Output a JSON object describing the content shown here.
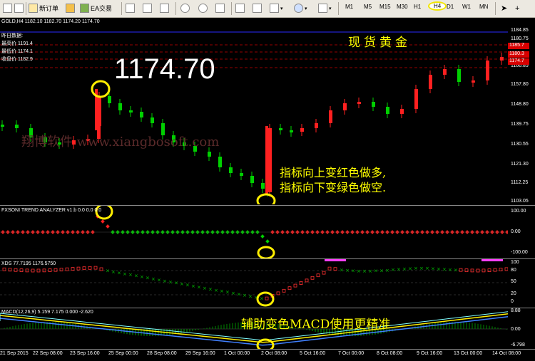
{
  "toolbar": {
    "new_order": "新订单",
    "ea": "EA交易",
    "timeframes": [
      "M1",
      "M5",
      "M15",
      "M30",
      "H1",
      "H4",
      "D1",
      "W1",
      "MN"
    ],
    "active_timeframe": "H4"
  },
  "main": {
    "header": "GOLD,H4  1182.10 1182.70 1174.20 1174.70",
    "info_title": "昨日数据:",
    "info_high": "最高价 1191.4",
    "info_low": "最低价 1174.1",
    "info_close": "收盘价 1182.9",
    "big_price": "1174.70",
    "watermark": "翔博软件 www.xiangbosoft.com",
    "title_cn": "现货黄金",
    "note_line1": "指标向上变红色做多,",
    "note_line2": "指标向下变绿色做空.",
    "price_labels": [
      "1184.85",
      "1180.75",
      "1176.65",
      "1172.55",
      "1166.85",
      "1157.80",
      "1148.80",
      "1139.75",
      "1130.55",
      "1121.30",
      "1112.25",
      "1103.05"
    ],
    "right_tags": [
      "1185.7",
      "1180.3",
      "1174.7"
    ]
  },
  "trend": {
    "header": "FXSONI TREND ANALYZER v1.b  0.0  0.0  0.0",
    "scale": [
      "100.00",
      "0.00",
      "-100.00"
    ]
  },
  "osc": {
    "header": "XDS 77.7195 1176.5750",
    "scale": [
      "100",
      "80",
      "50",
      "20",
      "0"
    ]
  },
  "macd": {
    "header": "MACD(12,26,9) 5.159 7.175 0.000 -2.620",
    "scale": [
      "8.88",
      "0.00",
      "-6.798"
    ],
    "note": "辅助变色MACD使用更精准"
  },
  "dates": [
    "21 Sep 2015",
    "22 Sep 08:00",
    "23 Sep 16:00",
    "25 Sep 00:00",
    "28 Sep 08:00",
    "29 Sep 16:00",
    "1 Oct 00:00",
    "2 Oct 08:00",
    "5 Oct 16:00",
    "7 Oct 00:00",
    "8 Oct 08:00",
    "9 Oct 16:00",
    "13 Oct 00:00",
    "14 Oct 08:00"
  ]
}
